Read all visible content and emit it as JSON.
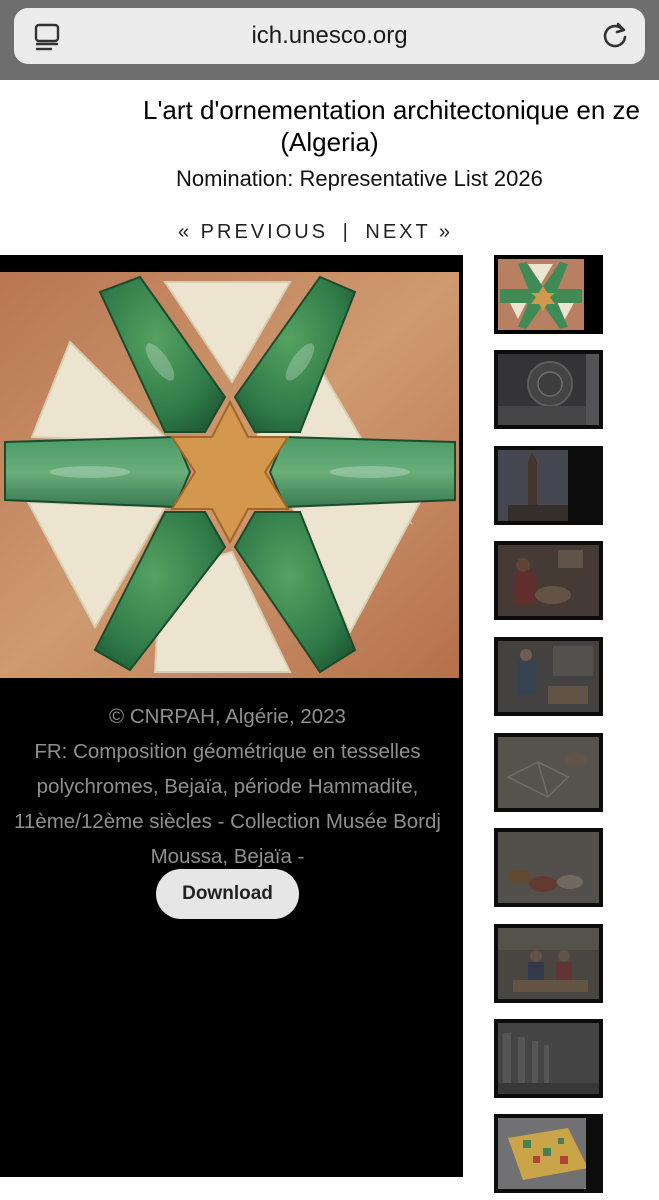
{
  "browser": {
    "url": "ich.unesco.org",
    "tabs_icon": "tabs-icon",
    "reload_icon": "reload-icon"
  },
  "header": {
    "title_line1": "L'art d'ornementation architectonique en ze",
    "title_line2": "(Algeria)",
    "nomination": "Nomination: Representative List 2026"
  },
  "pager": {
    "previous": "« PREVIOUS",
    "separator": "|",
    "next": "NEXT »"
  },
  "viewer": {
    "credit": "© CNRPAH, Algérie, 2023",
    "caption": "FR: Composition géométrique en tesselles polychromes, Bejaïa, période Hammadite, 11ème/12ème siècles - Collection Musée Bordj Moussa, Bejaïa -",
    "download_label": "Download"
  },
  "thumbnails": [
    {
      "name": "star-tile-composition",
      "selected": true
    },
    {
      "name": "carved-ceiling-rosette",
      "selected": false
    },
    {
      "name": "minaret-tower",
      "selected": false
    },
    {
      "name": "craftsman-workshop",
      "selected": false
    },
    {
      "name": "man-presenting-in-gallery",
      "selected": false
    },
    {
      "name": "hands-laying-tiles",
      "selected": false
    },
    {
      "name": "bowls-of-material",
      "selected": false
    },
    {
      "name": "two-artisans-at-table",
      "selected": false
    },
    {
      "name": "arched-corridor",
      "selected": false
    },
    {
      "name": "mosaic-table",
      "selected": false
    }
  ],
  "colors": {
    "browser_bar": "#6e6e6e",
    "url_pill": "#ececec",
    "viewer_bg": "#000000",
    "caption_text": "#8f8f8f",
    "green_tile": "#3f8a55",
    "cream_tile": "#ede6d2",
    "amber_star": "#d59a52",
    "wood": "#c48a60"
  }
}
